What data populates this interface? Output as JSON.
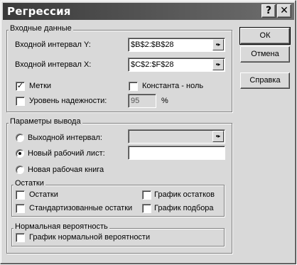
{
  "window": {
    "title": "Регрессия",
    "help_glyph": "?",
    "close_glyph": "✕"
  },
  "buttons": {
    "ok": "ОК",
    "cancel": "Отмена",
    "help": "Справка"
  },
  "input_group": {
    "title": "Входные данные",
    "y_range_label": "Входной интервал Y:",
    "y_range_value": "$B$2:$B$28",
    "x_range_label": "Входной интервал X:",
    "x_range_value": "$C$2:$F$28",
    "labels_label": "Метки",
    "labels_checked": true,
    "constant_zero_label": "Константа - ноль",
    "constant_zero_checked": false,
    "confidence_label": "Уровень надежности:",
    "confidence_checked": false,
    "confidence_value": "95",
    "confidence_unit": "%"
  },
  "output_group": {
    "title": "Параметры вывода",
    "output_range_label": "Выходной интервал:",
    "output_range_value": "",
    "new_worksheet_label": "Новый рабочий лист:",
    "new_worksheet_value": "",
    "new_workbook_label": "Новая рабочая книга",
    "selected_option": "new_worksheet"
  },
  "residuals_group": {
    "title": "Остатки",
    "residuals_label": "Остатки",
    "standardized_label": "Стандартизованные остатки",
    "residual_plots_label": "График остатков",
    "line_fit_label": "График подбора"
  },
  "probability_group": {
    "title": "Нормальная вероятность",
    "normal_plot_label": "График нормальной вероятности"
  },
  "colors": {
    "dialog_bg": "#d9d9d9",
    "titlebar_start": "#3a3a3a",
    "titlebar_end": "#6e6e6e"
  },
  "icons": {
    "range_picker": "collapse-dialog-icon",
    "checked_mark": "✓"
  }
}
